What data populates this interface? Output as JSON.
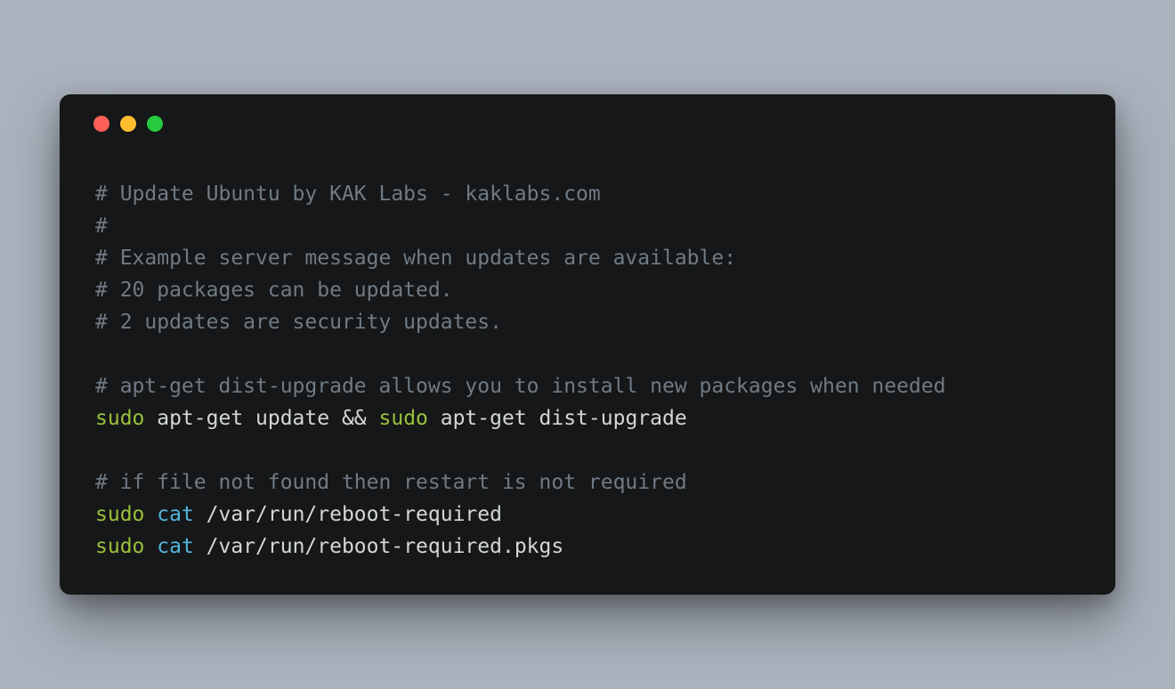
{
  "comments": {
    "c1": "# Update Ubuntu by KAK Labs - kaklabs.com",
    "c2": "#",
    "c3": "# Example server message when updates are available:",
    "c4": "# 20 packages can be updated.",
    "c5": "# 2 updates are security updates.",
    "c6": "# apt-get dist-upgrade allows you to install new packages when needed",
    "c7": "# if file not found then restart is not required"
  },
  "tokens": {
    "sudo": "sudo",
    "cat": "cat",
    "apt_update": " apt-get update && ",
    "apt_dist": " apt-get dist-upgrade",
    "reboot_req": " /var/run/reboot-required",
    "reboot_pkgs": " /var/run/reboot-required.pkgs"
  }
}
